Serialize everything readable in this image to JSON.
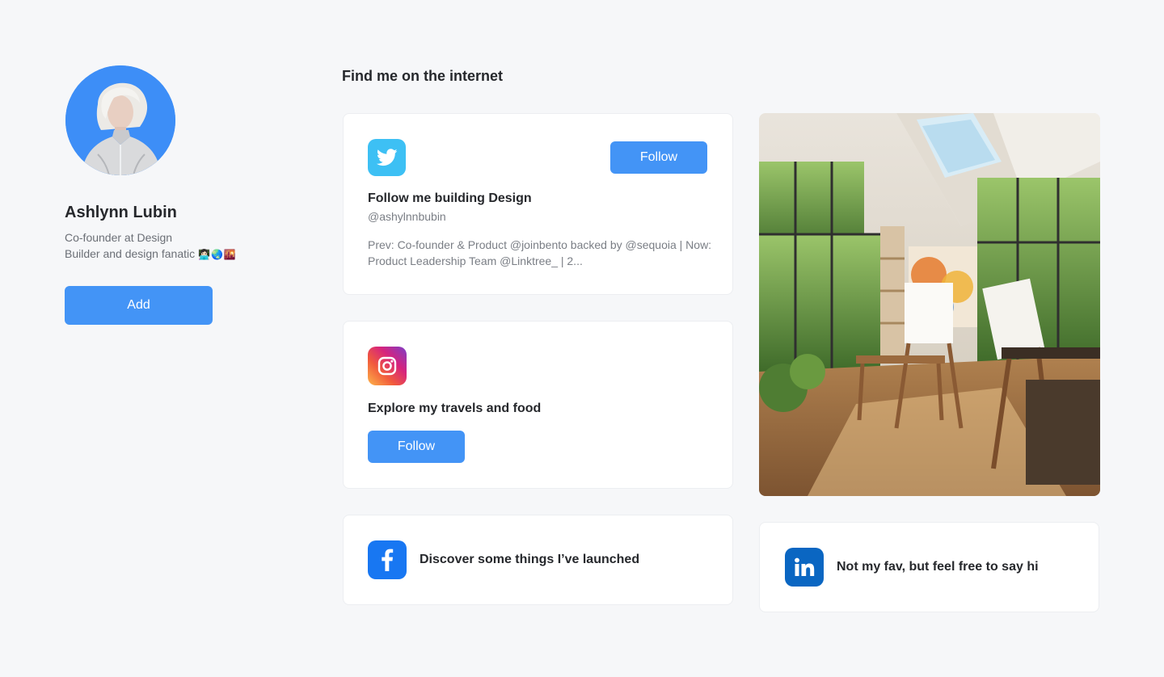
{
  "profile": {
    "name": "Ashlynn Lubin",
    "bio_line1": "Co-founder at Design",
    "bio_line2": "Builder and design fanatic",
    "bio_emoji": "👩🏻‍💻🌏🌇",
    "add_label": "Add"
  },
  "section": {
    "title": "Find me on the internet"
  },
  "twitter": {
    "icon": "twitter-bird-icon",
    "title": "Follow me building Design",
    "handle": "@ashylnnbubin",
    "description": "Prev: Co-founder & Product @joinbento backed by @sequoia | Now: Product Leadership Team @Linktree_ | 2...",
    "follow_label": "Follow",
    "color": "#3dc0f4"
  },
  "instagram": {
    "icon": "instagram-icon",
    "title": "Explore my travels and food",
    "follow_label": "Follow"
  },
  "facebook": {
    "icon": "facebook-icon",
    "title": "Discover some things I’ve launched",
    "color": "#1877f2"
  },
  "linkedin": {
    "icon": "linkedin-icon",
    "title": "Not my fav, but feel free to say hi",
    "color": "#0a66c2"
  },
  "colors": {
    "accent": "#4394f6",
    "background": "#f6f7f9",
    "card": "#ffffff"
  }
}
